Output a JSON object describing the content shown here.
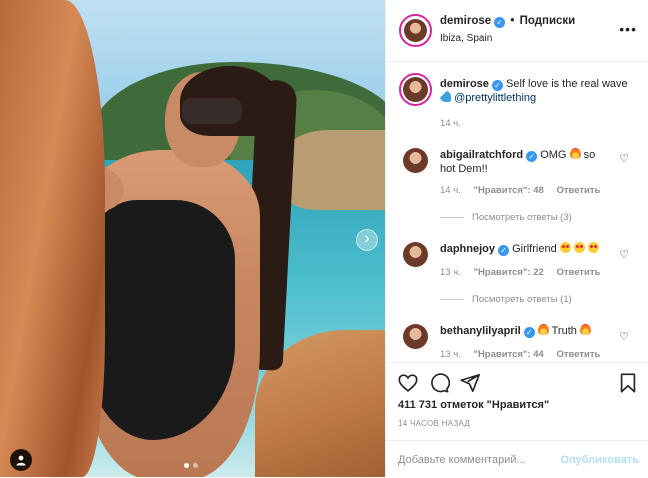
{
  "header": {
    "username": "demirose",
    "separator": "•",
    "follow_label": "Подписки",
    "location": "Ibiza, Spain",
    "more_icon": "more-horizontal-icon"
  },
  "caption": {
    "username": "demirose",
    "text": "Self love is the real wave",
    "mention": "@prettylittlething",
    "time": "14 ч."
  },
  "comments": [
    {
      "username": "abigailratchford",
      "text": "OMG",
      "text_after": "so hot Dem!!",
      "time": "14 ч.",
      "likes": "\"Нравится\": 48",
      "reply": "Ответить",
      "view_replies": "Посмотреть ответы (3)"
    },
    {
      "username": "daphnejoy",
      "text": "Girlfriend",
      "time": "13 ч.",
      "likes": "\"Нравится\": 22",
      "reply": "Ответить",
      "view_replies": "Посмотреть ответы (1)"
    },
    {
      "username": "bethanylilyapril",
      "text": "Truth",
      "time": "13 ч.",
      "likes": "\"Нравится\": 44",
      "reply": "Ответить"
    }
  ],
  "actions": {
    "likes": "411 731 отметок \"Нравится\"",
    "time": "14 ЧАСОВ НАЗАД"
  },
  "add_comment": {
    "placeholder": "Добавьте комментарий...",
    "publish": "Опубликовать"
  },
  "colors": {
    "verified": "#3897f0",
    "story_ring": "#d6249f",
    "publish_disabled": "#b2dffc"
  }
}
